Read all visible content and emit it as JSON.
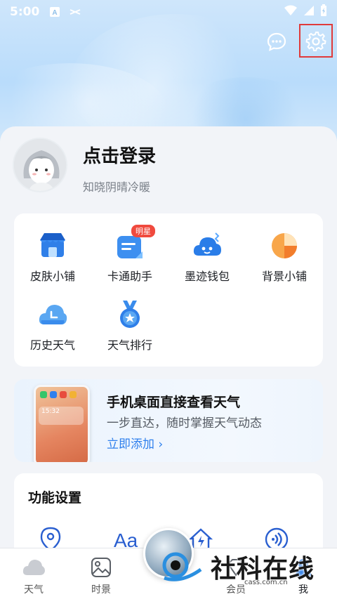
{
  "status_bar": {
    "time": "5:00"
  },
  "profile": {
    "title": "点击登录",
    "subtitle": "知晓阴晴冷暖"
  },
  "tools": [
    {
      "label": "皮肤小铺",
      "icon": "shop-icon"
    },
    {
      "label": "卡通助手",
      "icon": "card-assistant-icon",
      "badge": "明星"
    },
    {
      "label": "墨迹钱包",
      "icon": "wallet-cloud-icon"
    },
    {
      "label": "背景小铺",
      "icon": "background-shop-icon"
    },
    {
      "label": "历史天气",
      "icon": "history-weather-icon"
    },
    {
      "label": "天气排行",
      "icon": "ranking-medal-icon"
    }
  ],
  "promo": {
    "title": "手机桌面直接查看天气",
    "description": "一步直达，随时掌握天气动态",
    "link": "立即添加 ›",
    "widget_time": "15:32"
  },
  "settings": {
    "title": "功能设置"
  },
  "bottom_nav": [
    {
      "label": "天气",
      "icon": "weather-cloud-icon"
    },
    {
      "label": "时景",
      "icon": "photo-icon"
    },
    {
      "label": "会员",
      "icon": "member-icon"
    },
    {
      "label": "我",
      "icon": "profile-icon"
    }
  ],
  "watermark": {
    "text": "社科在线",
    "domain": "cass.com.cn"
  },
  "colors": {
    "accent": "#2f80ed",
    "highlight_border": "#e03a3a",
    "badge": "#f04a3e"
  }
}
